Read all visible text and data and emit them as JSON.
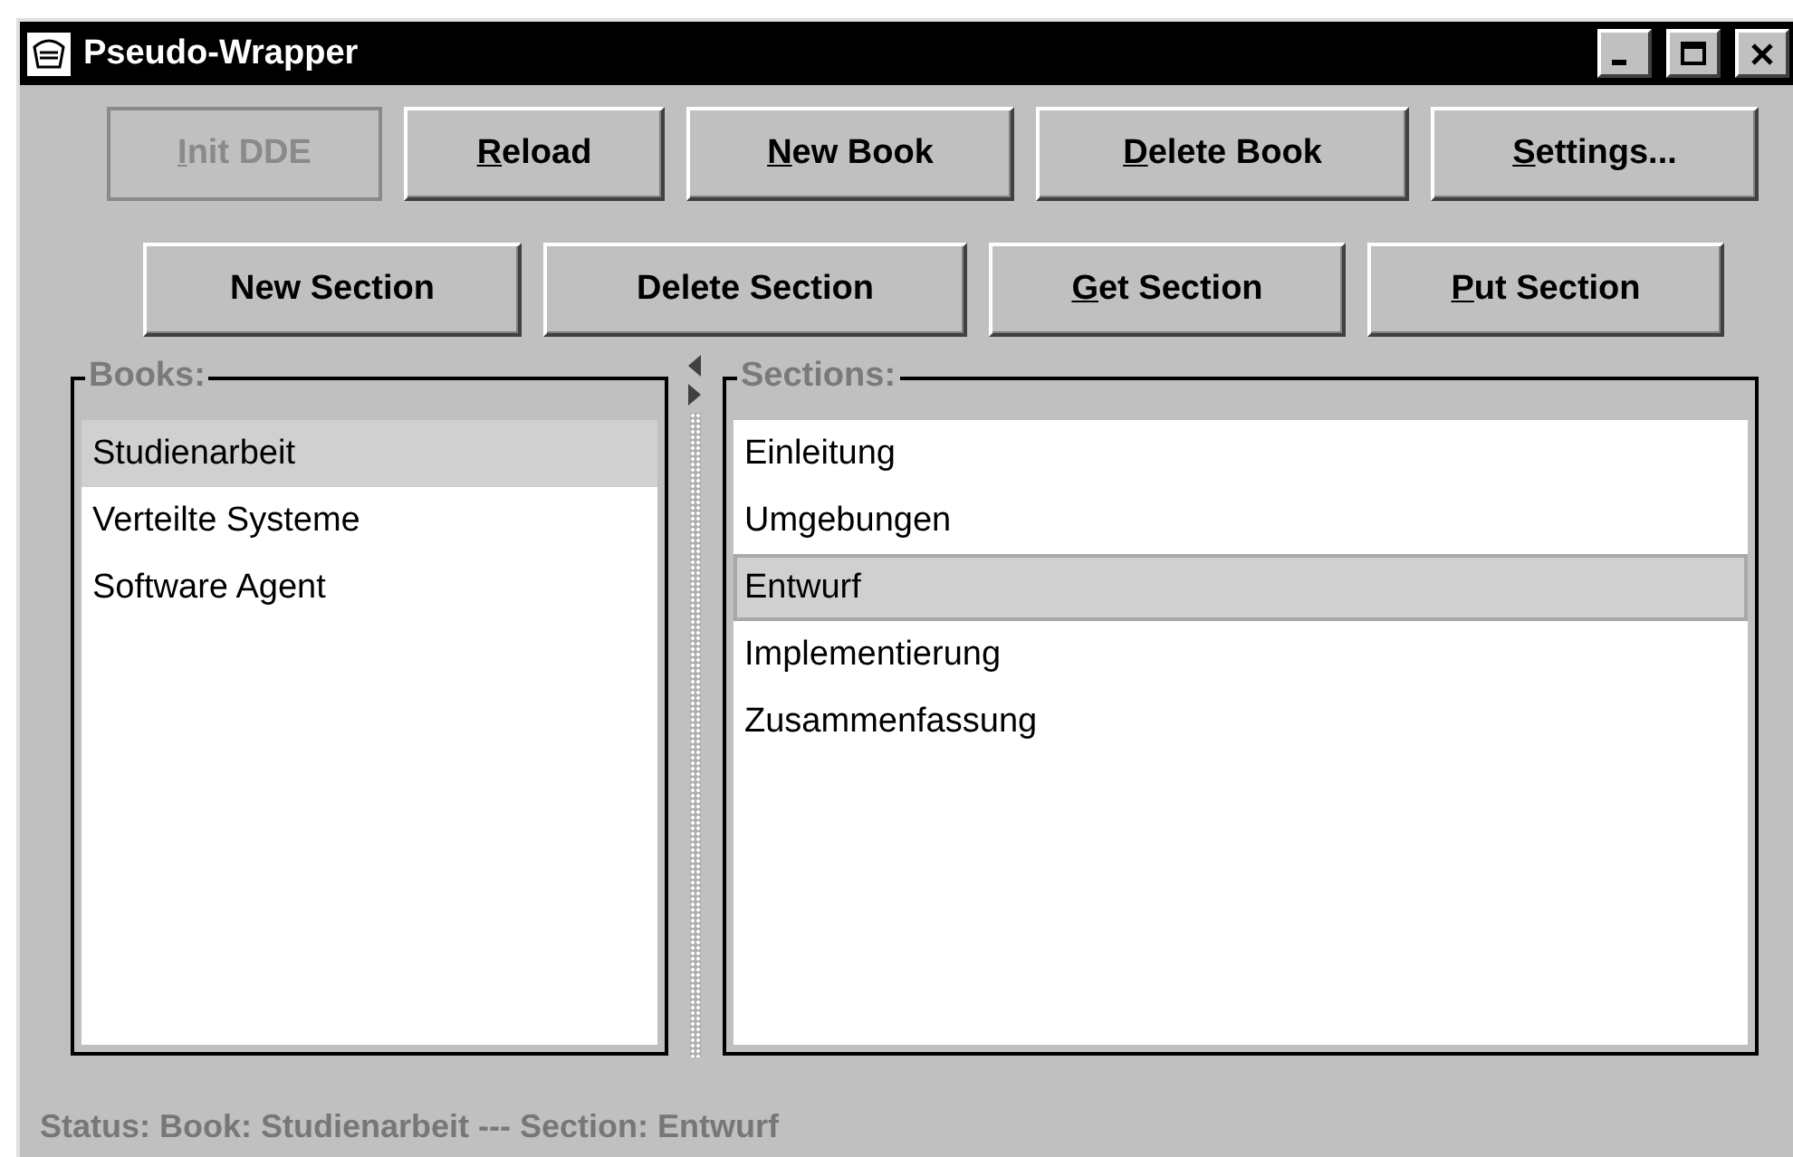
{
  "window": {
    "title": "Pseudo-Wrapper"
  },
  "toolbar_rows": [
    [
      {
        "label": "Init DDE",
        "mnemonic": true,
        "disabled": true
      },
      {
        "label": "Reload",
        "mnemonic": true,
        "disabled": false
      },
      {
        "label": "New Book",
        "mnemonic": true,
        "disabled": false
      },
      {
        "label": "Delete Book",
        "mnemonic": true,
        "disabled": false
      },
      {
        "label": "Settings...",
        "mnemonic": true,
        "disabled": false
      }
    ],
    [
      {
        "label": "New Section",
        "mnemonic": false,
        "disabled": false
      },
      {
        "label": "Delete Section",
        "mnemonic": false,
        "disabled": false
      },
      {
        "label": "Get Section",
        "mnemonic": true,
        "disabled": false
      },
      {
        "label": "Put Section",
        "mnemonic": true,
        "disabled": false
      }
    ]
  ],
  "books": {
    "title": "Books:",
    "items": [
      {
        "label": "Studienarbeit",
        "selected": true
      },
      {
        "label": "Verteilte Systeme",
        "selected": false
      },
      {
        "label": "Software Agent",
        "selected": false
      }
    ]
  },
  "sections": {
    "title": "Sections:",
    "items": [
      {
        "label": "Einleitung",
        "selected": false
      },
      {
        "label": "Umgebungen",
        "selected": false
      },
      {
        "label": "Entwurf",
        "selected": true
      },
      {
        "label": "Implementierung",
        "selected": false
      },
      {
        "label": "Zusammenfassung",
        "selected": false
      }
    ]
  },
  "status_bar": "Status: Book: Studienarbeit --- Section: Entwurf"
}
